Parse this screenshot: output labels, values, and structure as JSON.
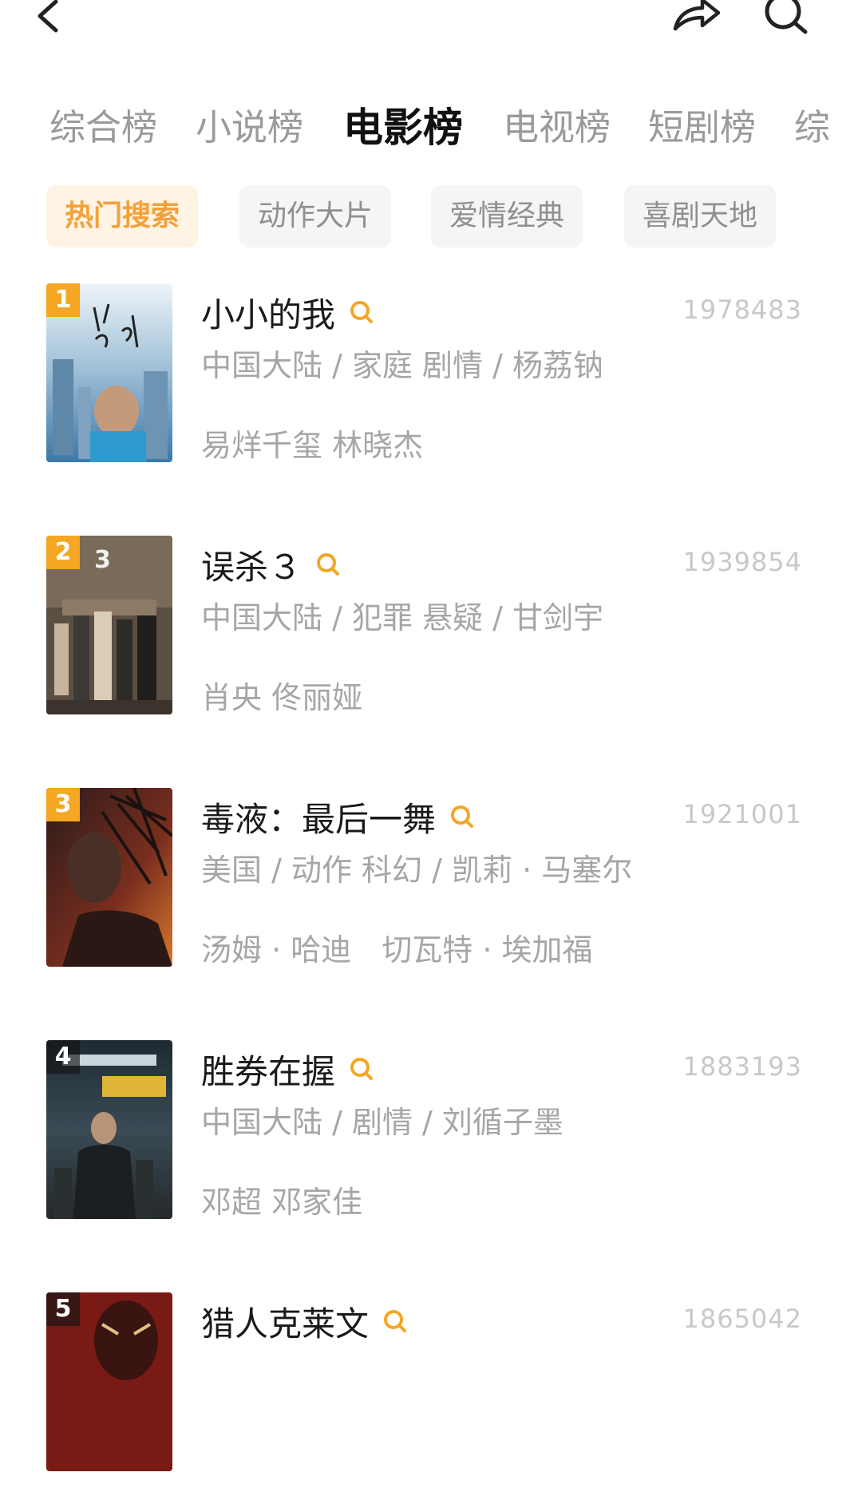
{
  "header": {
    "back_icon": "chevron-left-icon",
    "share_icon": "share-icon",
    "search_icon": "search-icon"
  },
  "tabs": [
    {
      "label": "综合榜",
      "active": false
    },
    {
      "label": "小说榜",
      "active": false
    },
    {
      "label": "电影榜",
      "active": true
    },
    {
      "label": "电视榜",
      "active": false
    },
    {
      "label": "短剧榜",
      "active": false
    },
    {
      "label": "综",
      "active": false
    }
  ],
  "chips": [
    {
      "label": "热门搜索",
      "active": true
    },
    {
      "label": "动作大片",
      "active": false
    },
    {
      "label": "爱情经典",
      "active": false
    },
    {
      "label": "喜剧天地",
      "active": false
    }
  ],
  "colors": {
    "accent": "#f5a623",
    "chip_active_bg": "#fff3e4",
    "chip_active_text": "#f2a13a",
    "muted_text": "#a6a6a6"
  },
  "movies": [
    {
      "rank": "1",
      "title": "小小的我",
      "count": "1978483",
      "meta": "中国大陆 / 家庭 剧情 / 杨荔钠",
      "cast": "易烊千玺 林晓杰"
    },
    {
      "rank": "2",
      "title": "误杀３",
      "count": "1939854",
      "meta": "中国大陆 / 犯罪 悬疑 / 甘剑宇",
      "cast": "肖央 佟丽娅"
    },
    {
      "rank": "3",
      "title": "毒液：最后一舞",
      "count": "1921001",
      "meta": "美国 / 动作 科幻 / 凯莉 · 马塞尔",
      "cast": "汤姆 · 哈迪　切瓦特 · 埃加福"
    },
    {
      "rank": "4",
      "title": "胜券在握",
      "count": "1883193",
      "meta": "中国大陆 / 剧情 / 刘循子墨",
      "cast": "邓超 邓家佳"
    },
    {
      "rank": "5",
      "title": "猎人克莱文",
      "count": "1865042",
      "meta": "",
      "cast": ""
    }
  ]
}
